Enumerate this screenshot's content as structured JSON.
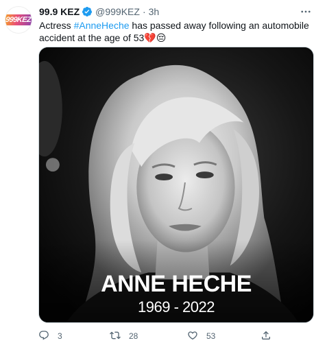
{
  "tweet": {
    "avatar_text": "999KEZ",
    "display_name": "99.9 KEZ",
    "handle": "@999KEZ",
    "separator": "·",
    "time": "3h",
    "text_before": "Actress ",
    "hashtag": "#AnneHeche",
    "text_after": " has passed away following an automobile accident at the age of 53💔😔",
    "image_overlay": {
      "name": "ANNE HECHE",
      "years": "1969 - 2022"
    },
    "actions": {
      "replies": "3",
      "retweets": "28",
      "likes": "53"
    }
  },
  "icons": {
    "verified": "verified-badge-icon",
    "more": "more-dots-icon",
    "reply": "reply-icon",
    "retweet": "retweet-icon",
    "like": "heart-icon",
    "share": "share-icon"
  },
  "colors": {
    "accent": "#1d9bf0",
    "secondary_text": "#536471",
    "primary_text": "#0f1419"
  }
}
